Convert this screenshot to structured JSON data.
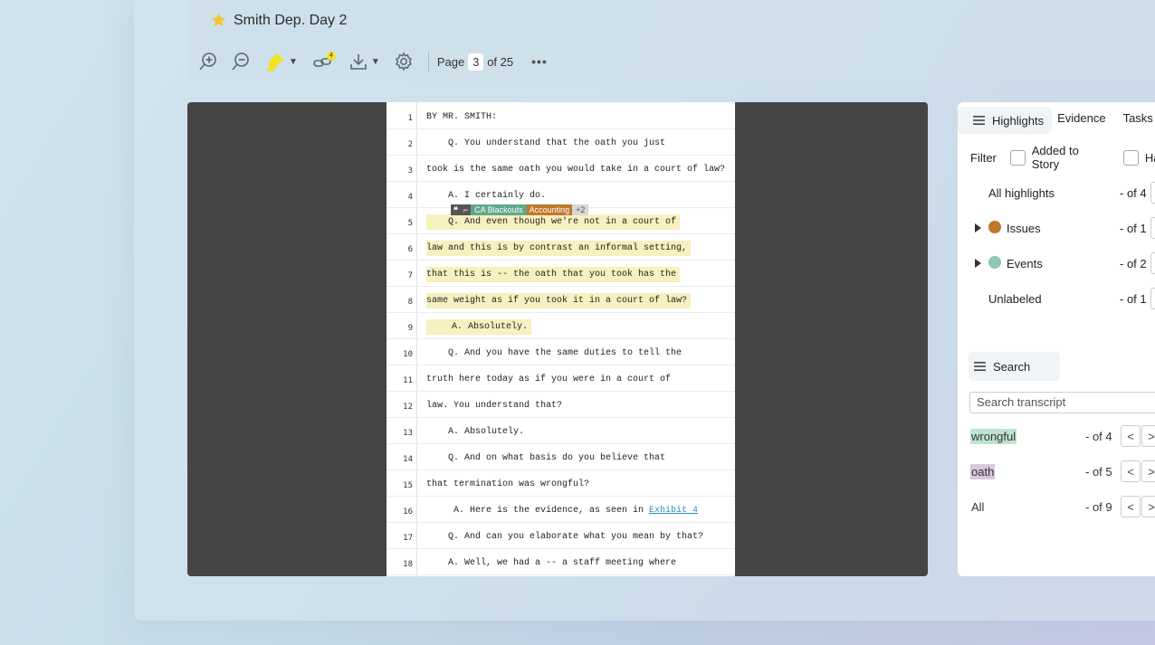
{
  "header": {
    "title": "Smith Dep. Day 2",
    "page_label": "Page",
    "page_current": "3",
    "page_total": "of 25",
    "links_badge": "4",
    "more": "•••"
  },
  "colors": {
    "highlight": "#f7f0bf",
    "issues": "#c0782a",
    "events": "#8dc8b0",
    "tag_ca": "#5fa98b",
    "tag_accounting": "#c0782a",
    "term_wrongful": "#bfe3cf",
    "term_oath": "#d9c7e0"
  },
  "transcript": {
    "lines": [
      {
        "n": "1",
        "text": "BY MR. SMITH:"
      },
      {
        "n": "2",
        "text": "    Q. You understand that the oath you just"
      },
      {
        "n": "3",
        "text": "took is the same oath you would take in a court of law?"
      },
      {
        "n": "4",
        "text": "    A. I certainly do."
      },
      {
        "n": "5",
        "text": "    Q. And even though we're not in a court of"
      },
      {
        "n": "6",
        "text": "law and this is by contrast an informal setting,"
      },
      {
        "n": "7",
        "text": "that this is -- the oath that you took has the"
      },
      {
        "n": "8",
        "text": "same weight as if you took it in a court of law?"
      },
      {
        "n": "9",
        "text": "    A. Absolutely."
      },
      {
        "n": "10",
        "text": "    Q. And you have the same duties to tell the"
      },
      {
        "n": "11",
        "text": "truth here today as if you were in a court of"
      },
      {
        "n": "12",
        "text": "law. You understand that?"
      },
      {
        "n": "13",
        "text": "    A. Absolutely."
      },
      {
        "n": "14",
        "text": "    Q. And on what basis do you believe that"
      },
      {
        "n": "15",
        "text": "that termination was wrongful?"
      },
      {
        "n": "16",
        "text": "     A. Here is the evidence, as seen in "
      },
      {
        "n": "17",
        "text": "    Q. And can you elaborate what you mean by that?"
      },
      {
        "n": "18",
        "text": "    A. Well, we had a -- a staff meeting where"
      }
    ],
    "line16_link": "Exhibit 4",
    "tags": {
      "ca": "CA Blackouts",
      "accounting": "Accounting",
      "more": "+2"
    }
  },
  "sidebar": {
    "tabs": [
      "Highlights",
      "Evidence",
      "Tasks"
    ],
    "filter_label": "Filter",
    "filter_options": [
      "Added to Story",
      "Has"
    ],
    "categories": [
      {
        "label": "All highlights",
        "count": "- of 4"
      },
      {
        "label": "Issues",
        "count": "- of 1"
      },
      {
        "label": "Events",
        "count": "- of 2"
      },
      {
        "label": "Unlabeled",
        "count": "- of 1"
      }
    ],
    "search_tab": "Search",
    "search_placeholder": "Search transcript",
    "terms": [
      {
        "label": "wrongful",
        "count": "- of 4"
      },
      {
        "label": "oath",
        "count": "- of 5"
      },
      {
        "label": "All",
        "count": "- of 9"
      }
    ],
    "prev": "<",
    "next": ">"
  }
}
